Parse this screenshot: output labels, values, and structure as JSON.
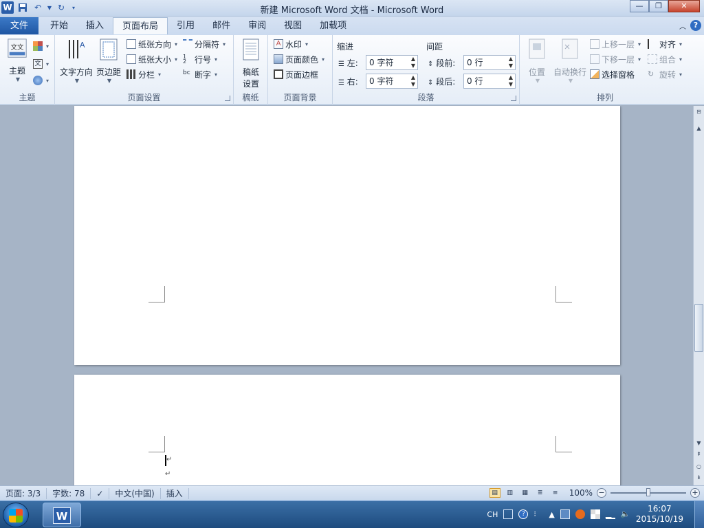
{
  "titlebar": {
    "title": "新建 Microsoft Word 文档 - Microsoft Word",
    "app_logo": "W",
    "minimize": "—",
    "maximize": "❐",
    "close": "✕"
  },
  "file_tab": "文件",
  "tabs": [
    "开始",
    "插入",
    "页面布局",
    "引用",
    "邮件",
    "审阅",
    "视图",
    "加载项"
  ],
  "ribbon": {
    "themes": {
      "label": "主题",
      "button": "主题"
    },
    "page_setup": {
      "label": "页面设置",
      "text_direction": "文字方向",
      "margins": "页边距",
      "orientation": "纸张方向",
      "size": "纸张大小",
      "columns": "分栏",
      "breaks": "分隔符",
      "line_numbers": "行号",
      "hyphenation": "断字"
    },
    "draft_paper": {
      "label": "稿纸",
      "button_line1": "稿纸",
      "button_line2": "设置"
    },
    "page_background": {
      "label": "页面背景",
      "watermark": "水印",
      "page_color": "页面颜色",
      "page_borders": "页面边框"
    },
    "paragraph": {
      "label": "段落",
      "indent_title": "缩进",
      "left_label": "左:",
      "left_value": "0 字符",
      "right_label": "右:",
      "right_value": "0 字符",
      "spacing_title": "间距",
      "before_label": "段前:",
      "before_value": "0 行",
      "after_label": "段后:",
      "after_value": "0 行"
    },
    "arrange": {
      "label": "排列",
      "position": "位置",
      "wrap_text": "自动换行",
      "bring_forward": "上移一层",
      "send_backward": "下移一层",
      "selection_pane": "选择窗格",
      "align": "对齐",
      "group": "组合",
      "rotate": "旋转"
    }
  },
  "document": {
    "paragraph_mark": "↵"
  },
  "statusbar": {
    "page": "页面: 3/3",
    "words": "字数: 78",
    "language": "中文(中国)",
    "mode": "插入",
    "zoom": "100%",
    "zoom_fraction": 0.5
  },
  "taskbar": {
    "word_button": "W",
    "lang": "CH",
    "time": "16:07",
    "date": "2015/10/19"
  }
}
